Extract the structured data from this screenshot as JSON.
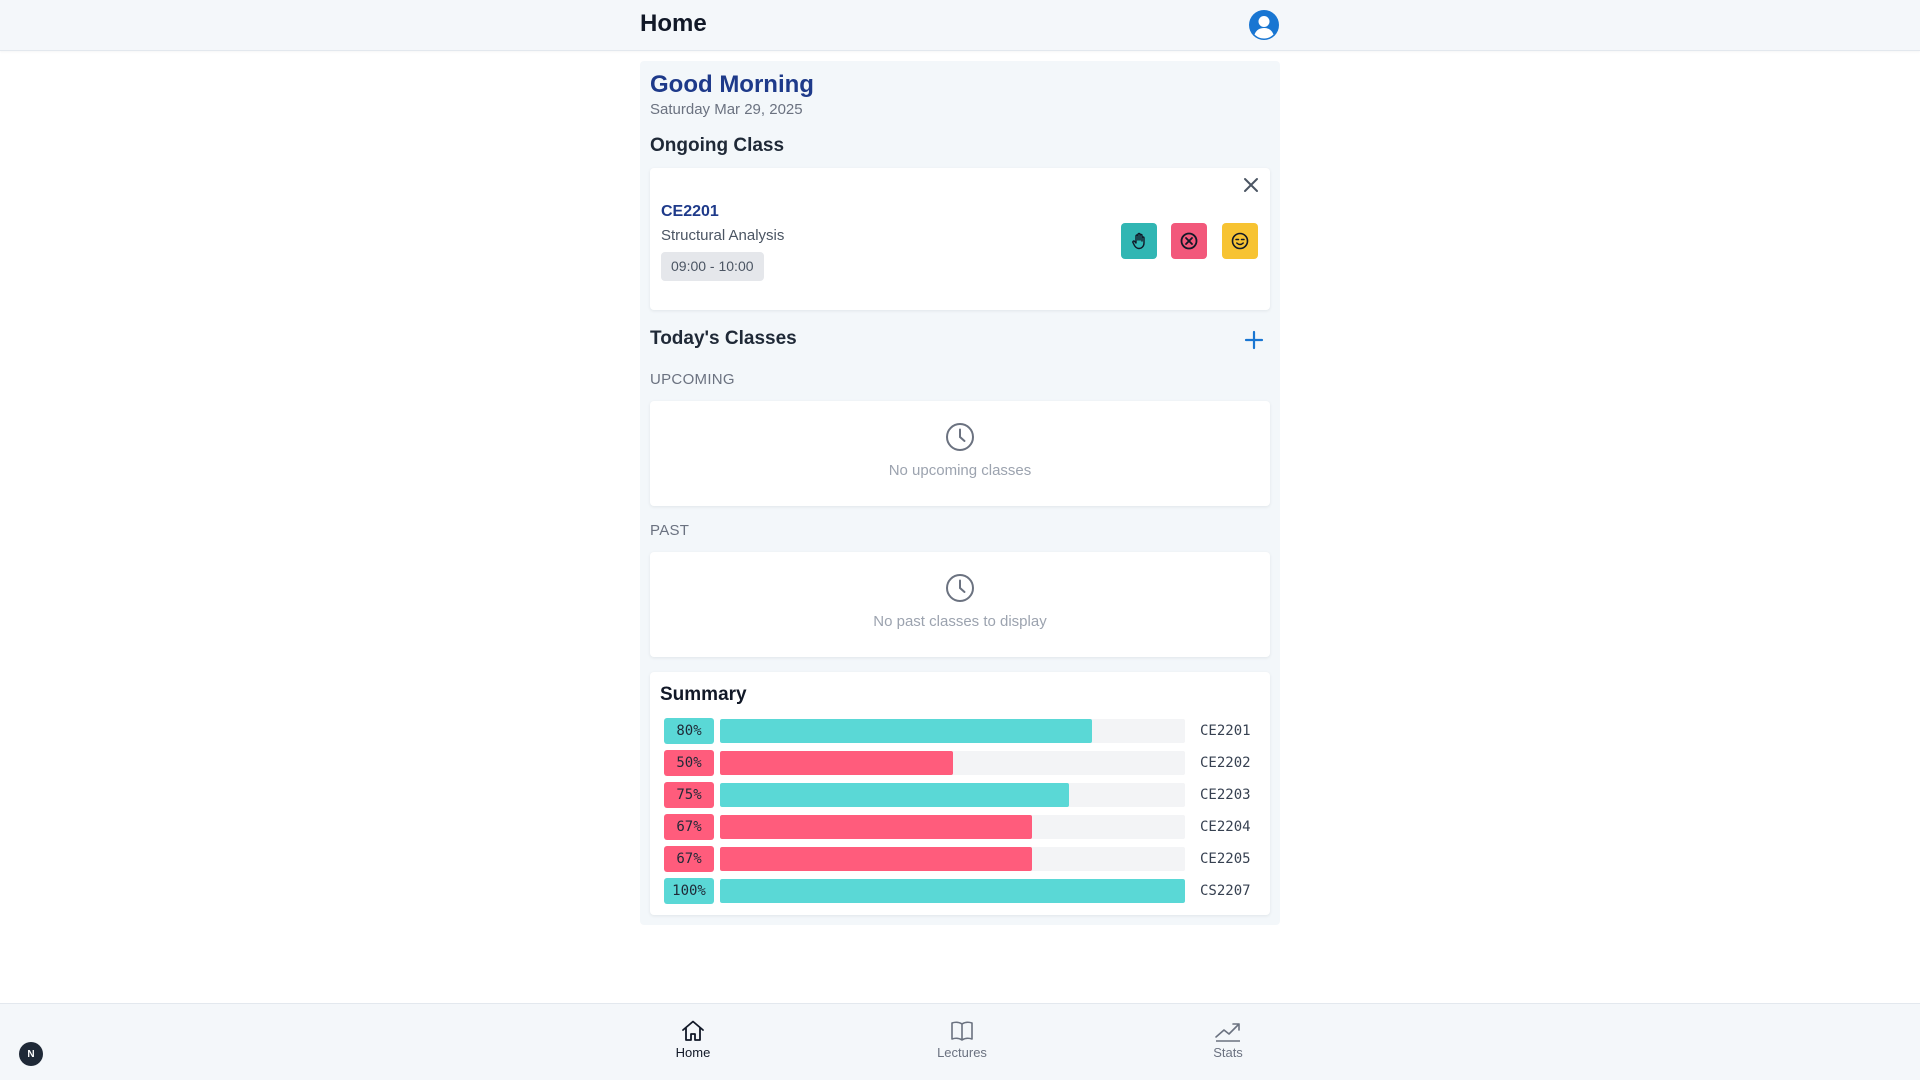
{
  "header": {
    "title": "Home",
    "avatar_icon": "user-circle-icon"
  },
  "greeting": {
    "text": "Good Morning",
    "date": "Saturday Mar 29, 2025"
  },
  "ongoing": {
    "title": "Ongoing Class",
    "code": "CE2201",
    "name": "Structural Analysis",
    "time": "09:00 - 10:00",
    "actions": [
      {
        "name": "present",
        "icon": "hand-icon",
        "color": "#31b6b3"
      },
      {
        "name": "absent",
        "icon": "x-circle-icon",
        "color": "#f2587b"
      },
      {
        "name": "excused",
        "icon": "face-icon",
        "color": "#f7c332"
      }
    ]
  },
  "today": {
    "title": "Today's Classes",
    "upcoming_label": "UPCOMING",
    "upcoming_empty": "No upcoming classes",
    "past_label": "PAST",
    "past_empty": "No past classes to display"
  },
  "summary": {
    "title": "Summary",
    "rows": [
      {
        "pct_label": "80%",
        "value": 0.8,
        "code": "CE2201",
        "color": "#5ad8d6",
        "badge": "#5ad8d6"
      },
      {
        "pct_label": "50%",
        "value": 0.5,
        "code": "CE2202",
        "color": "#ff5c7c",
        "badge": "#ff5c7c"
      },
      {
        "pct_label": "75%",
        "value": 0.75,
        "code": "CE2203",
        "color": "#5ad8d6",
        "badge": "#ff5c7c"
      },
      {
        "pct_label": "67%",
        "value": 0.67,
        "code": "CE2204",
        "color": "#ff5c7c",
        "badge": "#ff5c7c"
      },
      {
        "pct_label": "67%",
        "value": 0.67,
        "code": "CE2205",
        "color": "#ff5c7c",
        "badge": "#ff5c7c"
      },
      {
        "pct_label": "100%",
        "value": 1.0,
        "code": "CS2207",
        "color": "#5ad8d6",
        "badge": "#5ad8d6"
      }
    ]
  },
  "nav": {
    "home": "Home",
    "lectures": "Lectures",
    "stats": "Stats"
  },
  "badge": "N"
}
